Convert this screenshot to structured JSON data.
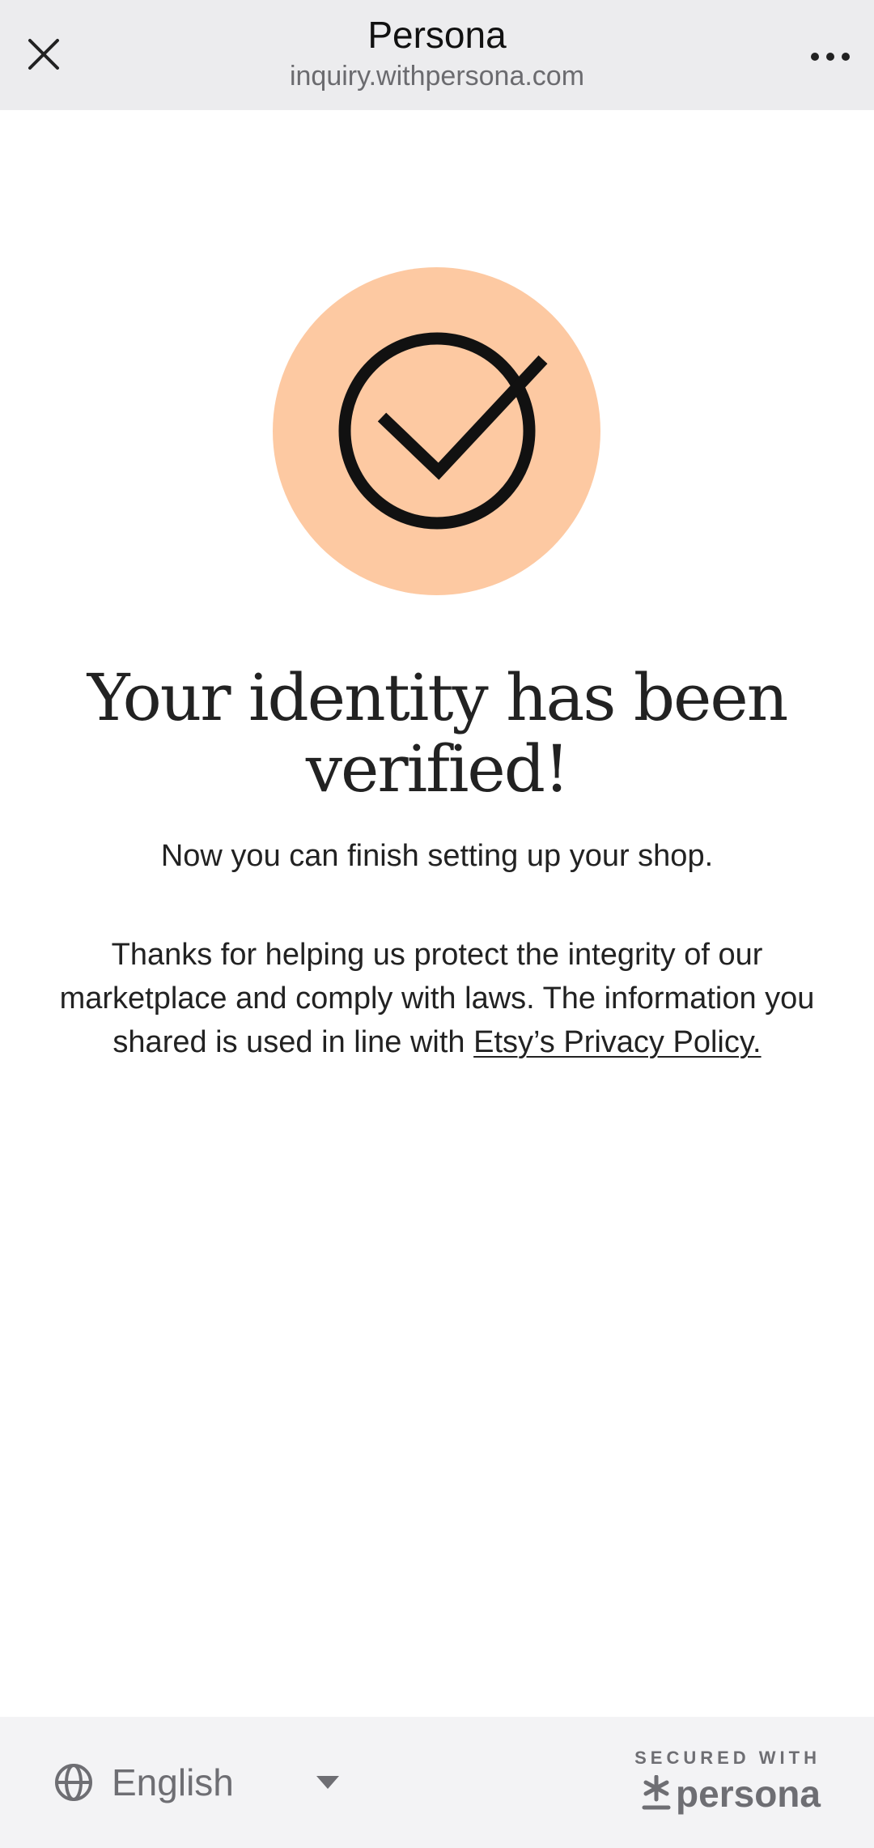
{
  "browser": {
    "title": "Persona",
    "url": "inquiry.withpersona.com"
  },
  "confirmation": {
    "headline_line1": "Your identity has been",
    "headline_line2": "verified!",
    "subtext": "Now you can finish setting up your shop.",
    "body_text": "Thanks for helping us protect the integrity of our marketplace and comply with laws. The information you shared is used in line with",
    "privacy_link_label": "Etsy’s Privacy Policy."
  },
  "footer": {
    "language": "English",
    "secured_label": "SECURED WITH",
    "brand_name": "persona"
  },
  "colors": {
    "check_circle_bg": "#fdc9a2",
    "topbar_bg": "#ececee",
    "footer_bg": "#f3f3f5"
  },
  "icons": {
    "close": "close-icon",
    "menu": "more-options-icon",
    "check": "check-circle-icon",
    "globe": "globe-icon",
    "caret": "caret-down-icon",
    "brand": "persona-asterisk-icon"
  }
}
